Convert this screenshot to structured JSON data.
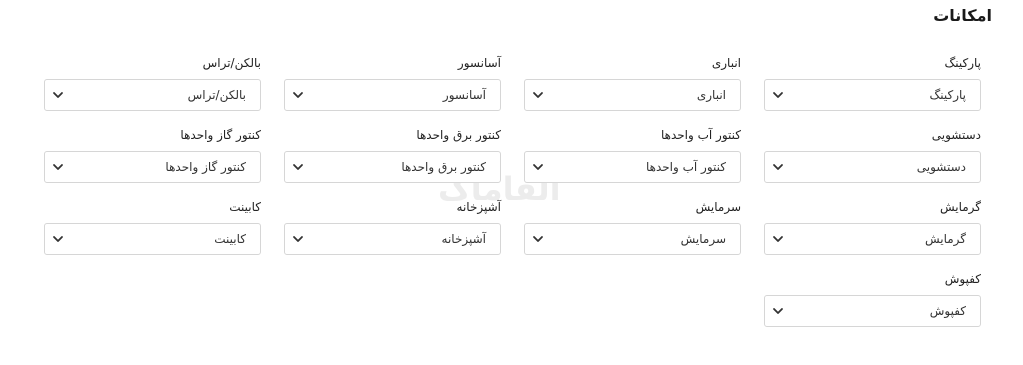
{
  "section": {
    "title": "امکانات"
  },
  "watermark": "الفاماک",
  "fields": [
    {
      "label": "پارکینگ",
      "value": "پارکینگ"
    },
    {
      "label": "انباری",
      "value": "انباری"
    },
    {
      "label": "آسانسور",
      "value": "آسانسور"
    },
    {
      "label": "بالکن/تراس",
      "value": "بالکن/تراس"
    },
    {
      "label": "دستشویی",
      "value": "دستشویی"
    },
    {
      "label": "کنتور آب واحدها",
      "value": "کنتور آب واحدها"
    },
    {
      "label": "کنتور برق واحدها",
      "value": "کنتور برق واحدها"
    },
    {
      "label": "کنتور گاز واحدها",
      "value": "کنتور گاز واحدها"
    },
    {
      "label": "گرمایش",
      "value": "گرمایش"
    },
    {
      "label": "سرمایش",
      "value": "سرمایش"
    },
    {
      "label": "آشپزخانه",
      "value": "آشپزخانه"
    },
    {
      "label": "کابینت",
      "value": "کابینت"
    },
    {
      "label": "کفپوش",
      "value": "کفپوش"
    }
  ]
}
